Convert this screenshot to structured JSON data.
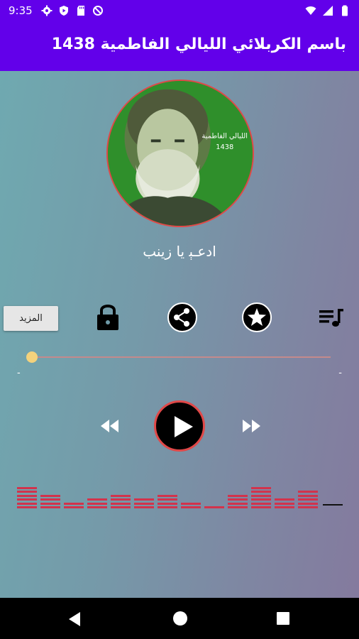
{
  "status_bar": {
    "time": "9:35",
    "left_icons": [
      "gear-icon",
      "shield-play-icon",
      "sd-card-icon",
      "blocked-icon"
    ],
    "right_icons": [
      "wifi-icon",
      "signal-icon",
      "battery-icon"
    ]
  },
  "app_bar": {
    "title": "باسم الكربلائي الليالي الفاطمية 1438"
  },
  "cover": {
    "overlay_text_line1": "الليالي الفاطمية",
    "overlay_text_line2": "1438"
  },
  "track": {
    "title": "ادعـﯧ يا زينب"
  },
  "actions": {
    "more_label": "المزيد",
    "icons": [
      "lock-icon",
      "share-icon",
      "star-icon",
      "playlist-icon"
    ]
  },
  "player": {
    "progress": 0.0,
    "elapsed": "-",
    "remaining": "-",
    "controls": [
      "rewind-icon",
      "play-icon",
      "fast-forward-icon"
    ]
  },
  "equalizer": {
    "levels": [
      6,
      4,
      2,
      3,
      4,
      3,
      4,
      2,
      1,
      4,
      6,
      3,
      5
    ],
    "color": "#d2334c"
  },
  "colors": {
    "app_bar": "#6200ea",
    "accent_red": "#e04848",
    "seek_thumb": "#f3d27c"
  },
  "nav_bar": {
    "icons": [
      "back-icon",
      "home-icon",
      "recents-icon"
    ]
  }
}
